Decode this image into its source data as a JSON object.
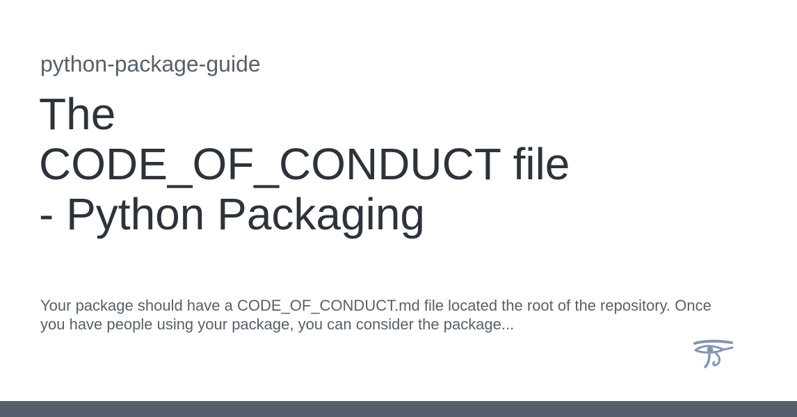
{
  "site": {
    "name": "python-package-guide"
  },
  "page": {
    "title": "The CODE_OF_CONDUCT file - Python Packaging",
    "description": "Your package should have a CODE_OF_CONDUCT.md file located the root of the repository. Once you have people using your package, you can consider the package..."
  },
  "logo": {
    "icon": "eye-of-horus-icon",
    "color": "#8393b4"
  },
  "footer": {
    "color": "#575d6a"
  }
}
